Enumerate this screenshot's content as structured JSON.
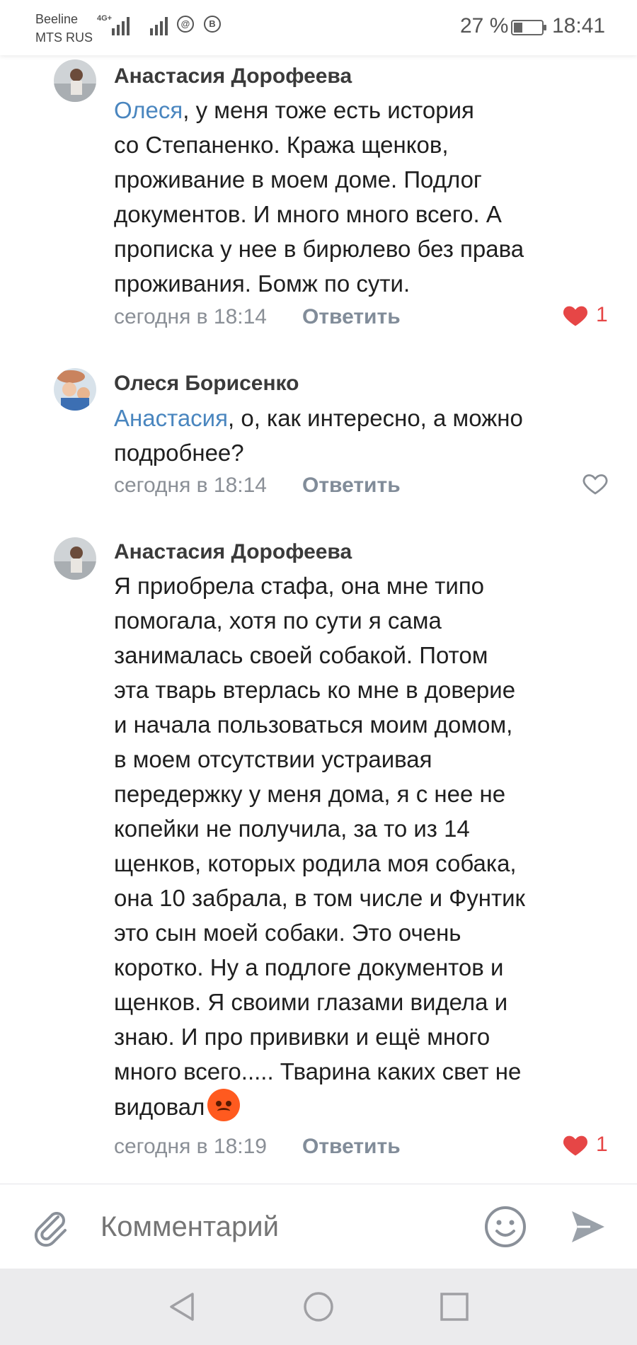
{
  "status_bar": {
    "carrier1": "Beeline",
    "carrier2": "MTS RUS",
    "network": "4G+",
    "battery": "27 %",
    "time": "18:41"
  },
  "comments": [
    {
      "author": "Анастасия Дорофеева",
      "mention": "Олеся",
      "lines": [
        ", у меня тоже есть история",
        "со Степаненко. Кража щенков,",
        "проживание в моем доме. Подлог",
        "документов. И много много всего. А",
        "прописка у нее в бирюлево без права",
        "проживания. Бомж по сути."
      ],
      "time": "сегодня в 18:14",
      "reply_label": "Ответить",
      "likes": "1",
      "liked": true
    },
    {
      "author": "Олеся Борисенко",
      "mention": "Анастасия",
      "lines": [
        ", о, как интересно, а можно",
        "подробнее?"
      ],
      "time": "сегодня в 18:14",
      "reply_label": "Ответить",
      "likes": "",
      "liked": false
    },
    {
      "author": "Анастасия Дорофеева",
      "mention": "",
      "lines": [
        "Я приобрела стафа, она мне типо",
        "помогала, хотя по сути я сама",
        "занималась своей собакой. Потом",
        "эта тварь втерлась ко мне в доверие",
        "и начала пользоваться моим домом,",
        "в моем отсутствии устраивая",
        "передержку у меня дома, я с нее не",
        "копейки не получила, за то из 14",
        "щенков, которых родила моя собака,",
        "она 10 забрала, в том числе и Фунтик",
        "это сын моей собаки. Это очень",
        "коротко. Ну а подлоге документов и",
        "щенков. Я своими глазами видела и",
        "знаю. И про прививки и ещё много",
        "много всего..... Тварина каких свет не",
        "видовал"
      ],
      "time": "сегодня в 18:19",
      "reply_label": "Ответить",
      "likes": "1",
      "liked": true
    }
  ],
  "composer": {
    "placeholder": "Комментарий"
  },
  "icons": {
    "attach": "paperclip-icon",
    "emoji": "smile-icon",
    "send": "send-icon",
    "nav": [
      "back-triangle-icon",
      "home-circle-icon",
      "recents-square-icon"
    ]
  },
  "colors": {
    "mention": "#4a86bf",
    "like": "#e64646",
    "meta": "#8a8f96",
    "navbar": "#ebebed"
  }
}
